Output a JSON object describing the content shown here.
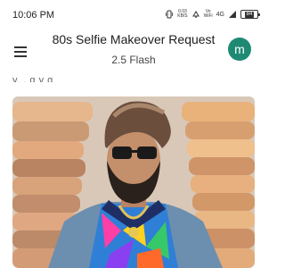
{
  "status_bar": {
    "time": "10:06 PM",
    "net_speed": "0.03",
    "net_speed_unit": "KB/S",
    "volte": "Vo",
    "volte_sub": "WiFi",
    "network": "4G",
    "battery": "84"
  },
  "header": {
    "title": "80s Selfie Makeover Request",
    "subtitle": "2.5 Flash",
    "avatar_letter": "m",
    "avatar_color": "#1e8a74"
  },
  "content": {
    "partial_text": "y, ,  g  y     g"
  },
  "photo": {
    "alt": "selfie photo"
  },
  "icons": [
    "menu-icon",
    "vibrate-icon",
    "alarm-icon",
    "wifi-icon",
    "signal-icon",
    "battery-icon"
  ]
}
